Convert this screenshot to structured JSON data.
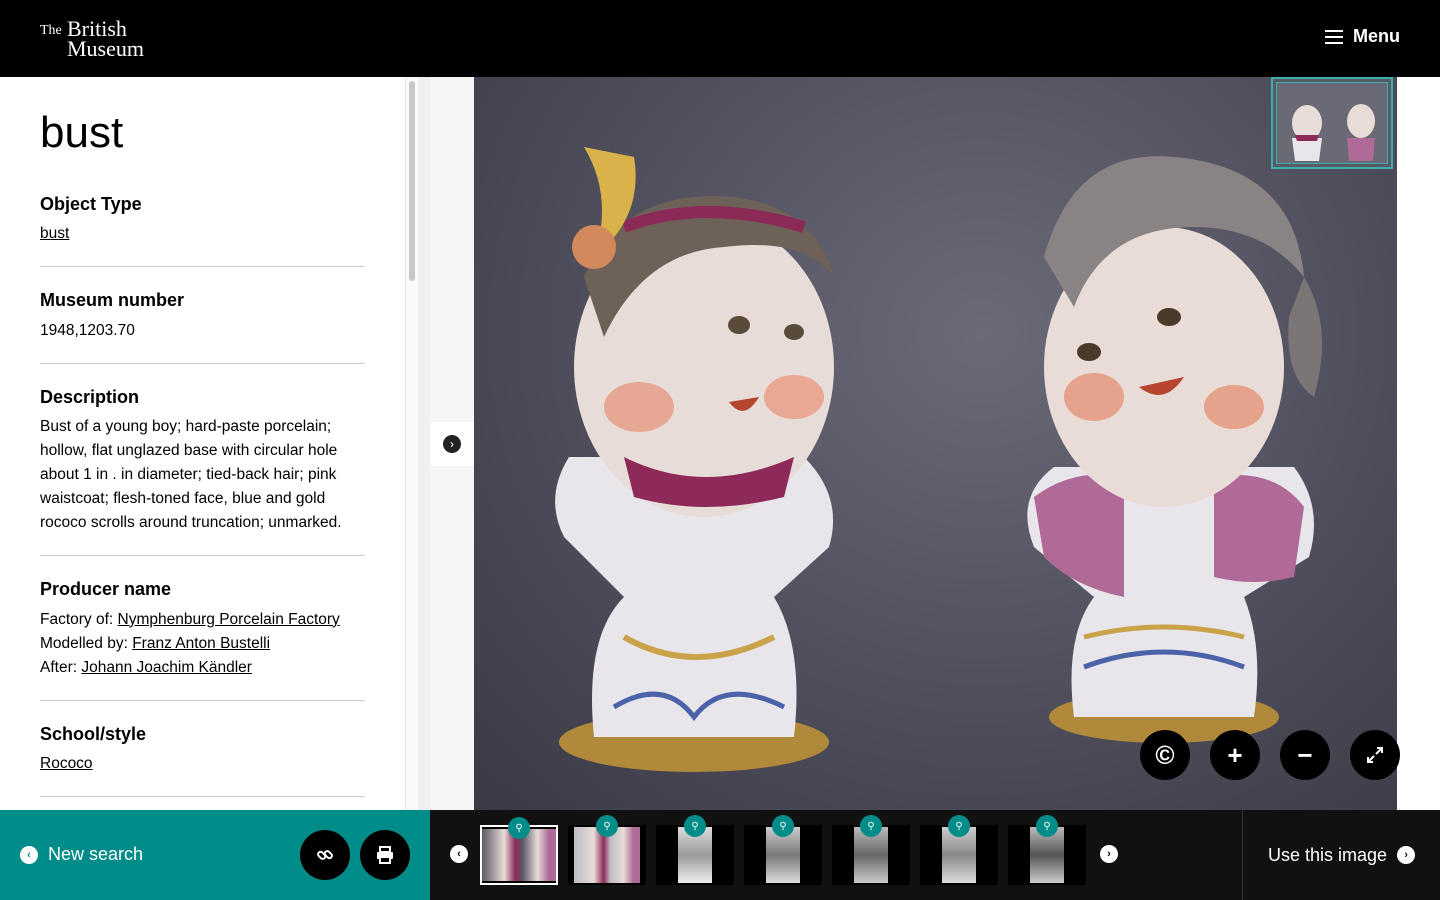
{
  "header": {
    "logo_the": "The",
    "logo_british": "British",
    "logo_museum": "Museum",
    "menu_label": "Menu"
  },
  "object": {
    "title": "bust",
    "fields": {
      "object_type": {
        "label": "Object Type",
        "value": "bust"
      },
      "museum_number": {
        "label": "Museum number",
        "value": "1948,1203.70"
      },
      "description": {
        "label": "Description",
        "value": "Bust of a young boy; hard-paste porcelain; hollow, flat unglazed base with circular hole about 1 in . in diameter; tied-back hair; pink waistcoat; flesh-toned face, blue and gold rococo scrolls around truncation; unmarked."
      },
      "producer": {
        "label": "Producer name",
        "lines": [
          {
            "role": "Factory of:",
            "name": "Nymphenburg Porcelain Factory"
          },
          {
            "role": "Modelled by:",
            "name": "Franz Anton Bustelli"
          },
          {
            "role": "After:",
            "name": "Johann Joachim Kändler"
          }
        ]
      },
      "school_style": {
        "label": "School/style",
        "value": "Rococo"
      }
    }
  },
  "viewer": {
    "controls": {
      "copyright_icon": "copyright-icon",
      "zoom_in": "+",
      "zoom_out": "−",
      "fullscreen_icon": "expand-icon"
    }
  },
  "bottom": {
    "new_search": "New search",
    "use_image": "Use this image",
    "thumbnails_count": 7
  },
  "colors": {
    "teal": "#008c88",
    "black": "#000000"
  }
}
